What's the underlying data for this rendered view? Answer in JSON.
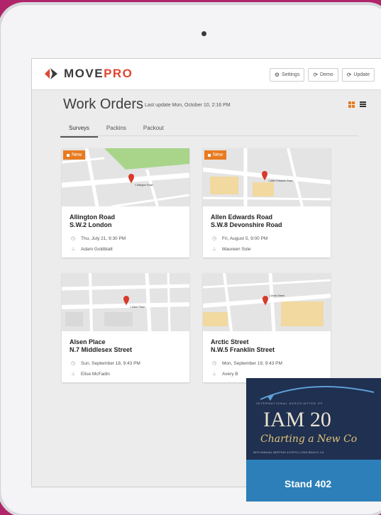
{
  "app": {
    "logo_part1": "MOVE",
    "logo_part2": "PRO",
    "actions": [
      {
        "label": "Settings",
        "icon": "gear-icon"
      },
      {
        "label": "Demo",
        "icon": "refresh-icon"
      },
      {
        "label": "Update",
        "icon": "refresh-icon"
      }
    ]
  },
  "page": {
    "title": "Work Orders",
    "last_update": "Last update Mon, October 10, 2:16 PM"
  },
  "tabs": [
    {
      "label": "Surveys",
      "active": true
    },
    {
      "label": "Packins",
      "active": false
    },
    {
      "label": "Packout",
      "active": false
    }
  ],
  "cards": [
    {
      "badge": "New",
      "map_label": "1 Allington Road",
      "line1": "Allington Road",
      "line2": "S.W.2 London",
      "date": "Thu, July 21, 9:30 PM",
      "person": "Adam Goldblatt"
    },
    {
      "badge": "New",
      "map_label": "1 Allen Edwards Road",
      "line1": "Allen Edwards Road",
      "line2": "S.W.8 Devonshire Road",
      "date": "Fri, August 5, 9:00 PM",
      "person": "Maureen Sole"
    },
    {
      "badge": "",
      "map_label": "1 Alsen Place",
      "line1": "Alsen Place",
      "line2": "N.7 Middlesex Street",
      "date": "Sun, September 18, 9:43 PM",
      "person": "Elise McFadin"
    },
    {
      "badge": "",
      "map_label": "1 Arctic Street",
      "line1": "Arctic Street",
      "line2": "N.W.5 Franklin Street",
      "date": "Mon, September 19, 9:43 PM",
      "person": "Avery B"
    }
  ],
  "banner": {
    "small_text": "INTERNATIONAL ASSOCIATION OF",
    "title": "IAM 20",
    "subtitle": "Charting a New Co",
    "annual": "56TH ANNUAL MEETING & EXPO | LONG BEACH, CA",
    "stand": "Stand 402"
  },
  "colors": {
    "background": "#b0246a",
    "accent": "#e87a1f",
    "logo_red": "#e0452e",
    "banner_blue": "#2c7fb8"
  }
}
